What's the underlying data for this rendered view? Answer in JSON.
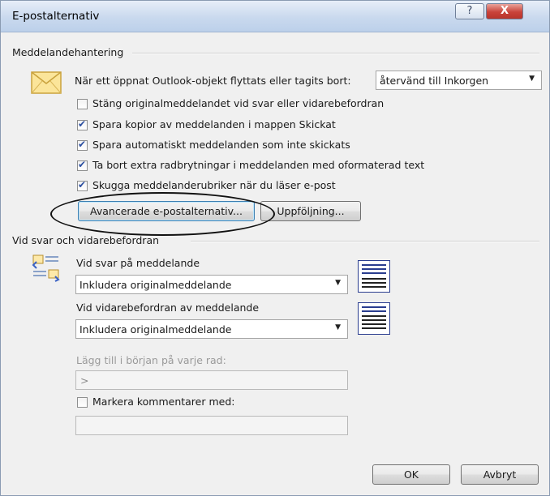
{
  "window": {
    "title": "E-postalternativ",
    "help_glyph": "?",
    "close_glyph": "X"
  },
  "message_handling": {
    "section_label": "Meddelandehantering",
    "move_label": "När ett öppnat Outlook-objekt flyttats eller tagits bort:",
    "move_select": "återvänd till Inkorgen",
    "options": [
      {
        "label": "Stäng originalmeddelandet vid svar eller vidarebefordran",
        "checked": false
      },
      {
        "label": "Spara kopior av meddelanden i mappen Skickat",
        "checked": true
      },
      {
        "label": "Spara automatiskt meddelanden som inte skickats",
        "checked": true
      },
      {
        "label": "Ta bort extra radbrytningar i meddelanden med oformaterad text",
        "checked": true
      },
      {
        "label": "Skugga meddelanderubriker när du läser e-post",
        "checked": true
      }
    ],
    "advanced_button": "Avancerade e-postalternativ...",
    "followup_button": "Uppföljning..."
  },
  "replies": {
    "section_label": "Vid svar och vidarebefordran",
    "reply_label": "Vid svar på meddelande",
    "reply_select": "Inkludera originalmeddelande",
    "forward_label": "Vid vidarebefordran av meddelande",
    "forward_select": "Inkludera originalmeddelande",
    "prefix_label": "Lägg till i början på varje rad:",
    "prefix_value": ">",
    "mark_comments_label": "Markera kommentarer med:",
    "mark_comments_checked": false,
    "mark_comments_value": ""
  },
  "footer": {
    "ok": "OK",
    "cancel": "Avbryt"
  }
}
